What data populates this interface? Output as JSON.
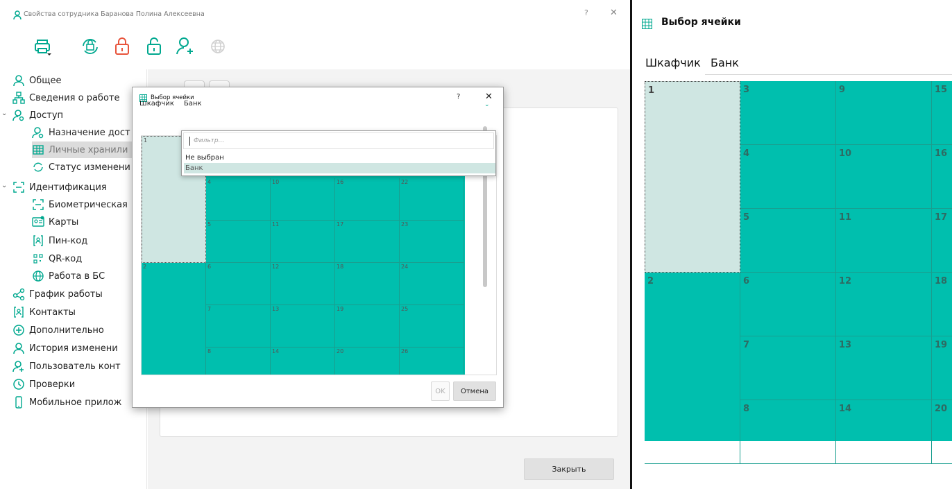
{
  "window": {
    "title": "Свойства сотрудника Баранова Полина  Алексеевна",
    "help": "?",
    "close": "✕"
  },
  "toolbar": {
    "icons": [
      "printer-icon",
      "refresh-lock-icon",
      "lock-icon",
      "unlock-icon",
      "user-add-icon",
      "globe-icon"
    ]
  },
  "sidebar": {
    "items": [
      {
        "label": "Общее",
        "icon": "user-icon"
      },
      {
        "label": "Сведения о работе",
        "icon": "org-icon"
      },
      {
        "label": "Доступ",
        "icon": "user-key-icon"
      },
      {
        "label": "Назначение дост",
        "icon": "user-key-icon"
      },
      {
        "label": "Личные хранили",
        "icon": "grid-icon"
      },
      {
        "label": "Статус изменени",
        "icon": "sync-icon"
      },
      {
        "label": "Идентификация",
        "icon": "id-icon"
      },
      {
        "label": "Биометрическая",
        "icon": "id-icon"
      },
      {
        "label": "Карты",
        "icon": "card-icon"
      },
      {
        "label": "Пин-код",
        "icon": "pin-icon"
      },
      {
        "label": "QR-код",
        "icon": "qr-icon"
      },
      {
        "label": "Работа в БС",
        "icon": "globe-icon"
      },
      {
        "label": "График работы",
        "icon": "share-icon"
      },
      {
        "label": "Контакты",
        "icon": "contacts-icon"
      },
      {
        "label": "Дополнительно",
        "icon": "plus-circle-icon"
      },
      {
        "label": "История изменени",
        "icon": "user-icon"
      },
      {
        "label": "Пользователь конт",
        "icon": "user-add-icon"
      },
      {
        "label": "Проверки",
        "icon": "clock-icon"
      },
      {
        "label": "Мобильное прилож",
        "icon": "phone-icon"
      }
    ]
  },
  "footer": {
    "close_label": "Закрыть"
  },
  "dialog": {
    "title": "Выбор ячейки",
    "help": "?",
    "close": "✕",
    "locker_label": "Шкафчик",
    "locker_value": "Банк",
    "filter_placeholder": "Фильтр...",
    "options": [
      "Не выбран",
      "Банк"
    ],
    "ok_label": "OK",
    "cancel_label": "Отмена",
    "cells": [
      {
        "n": "1",
        "col": 0,
        "row": 0,
        "rows": 3,
        "sel": true
      },
      {
        "n": "2",
        "col": 0,
        "row": 3,
        "rows": 3
      },
      {
        "n": "4",
        "col": 1,
        "row": 1
      },
      {
        "n": "5",
        "col": 1,
        "row": 2
      },
      {
        "n": "6",
        "col": 1,
        "row": 3
      },
      {
        "n": "7",
        "col": 1,
        "row": 4
      },
      {
        "n": "8",
        "col": 1,
        "row": 5
      },
      {
        "n": "10",
        "col": 2,
        "row": 1
      },
      {
        "n": "11",
        "col": 2,
        "row": 2
      },
      {
        "n": "12",
        "col": 2,
        "row": 3
      },
      {
        "n": "13",
        "col": 2,
        "row": 4
      },
      {
        "n": "14",
        "col": 2,
        "row": 5
      },
      {
        "n": "16",
        "col": 3,
        "row": 1
      },
      {
        "n": "17",
        "col": 3,
        "row": 2
      },
      {
        "n": "18",
        "col": 3,
        "row": 3
      },
      {
        "n": "19",
        "col": 3,
        "row": 4
      },
      {
        "n": "20",
        "col": 3,
        "row": 5
      },
      {
        "n": "22",
        "col": 4,
        "row": 1
      },
      {
        "n": "23",
        "col": 4,
        "row": 2
      },
      {
        "n": "24",
        "col": 4,
        "row": 3
      },
      {
        "n": "25",
        "col": 4,
        "row": 4
      },
      {
        "n": "26",
        "col": 4,
        "row": 5
      }
    ]
  },
  "zoom": {
    "title": "Выбор ячейки",
    "locker_label": "Шкафчик",
    "locker_value": "Банк",
    "cells": [
      {
        "n": "1",
        "col": 0,
        "row": 0,
        "rows": 3,
        "sel": true
      },
      {
        "n": "2",
        "col": 0,
        "row": 3,
        "rows": 3
      },
      {
        "n": "3",
        "col": 1,
        "row": 0
      },
      {
        "n": "4",
        "col": 1,
        "row": 1
      },
      {
        "n": "5",
        "col": 1,
        "row": 2
      },
      {
        "n": "6",
        "col": 1,
        "row": 3
      },
      {
        "n": "7",
        "col": 1,
        "row": 4
      },
      {
        "n": "8",
        "col": 1,
        "row": 5
      },
      {
        "n": "9",
        "col": 2,
        "row": 0
      },
      {
        "n": "10",
        "col": 2,
        "row": 1
      },
      {
        "n": "11",
        "col": 2,
        "row": 2
      },
      {
        "n": "12",
        "col": 2,
        "row": 3
      },
      {
        "n": "13",
        "col": 2,
        "row": 4
      },
      {
        "n": "14",
        "col": 2,
        "row": 5
      },
      {
        "n": "15",
        "col": 3,
        "row": 0
      },
      {
        "n": "16",
        "col": 3,
        "row": 1
      },
      {
        "n": "17",
        "col": 3,
        "row": 2
      },
      {
        "n": "18",
        "col": 3,
        "row": 3
      },
      {
        "n": "19",
        "col": 3,
        "row": 4
      },
      {
        "n": "20",
        "col": 3,
        "row": 5
      }
    ]
  },
  "colors": {
    "accent": "#00bfae",
    "icon_green": "#00a88f",
    "icon_red": "#e8543c",
    "selected_cell": "#cfe6e2"
  }
}
